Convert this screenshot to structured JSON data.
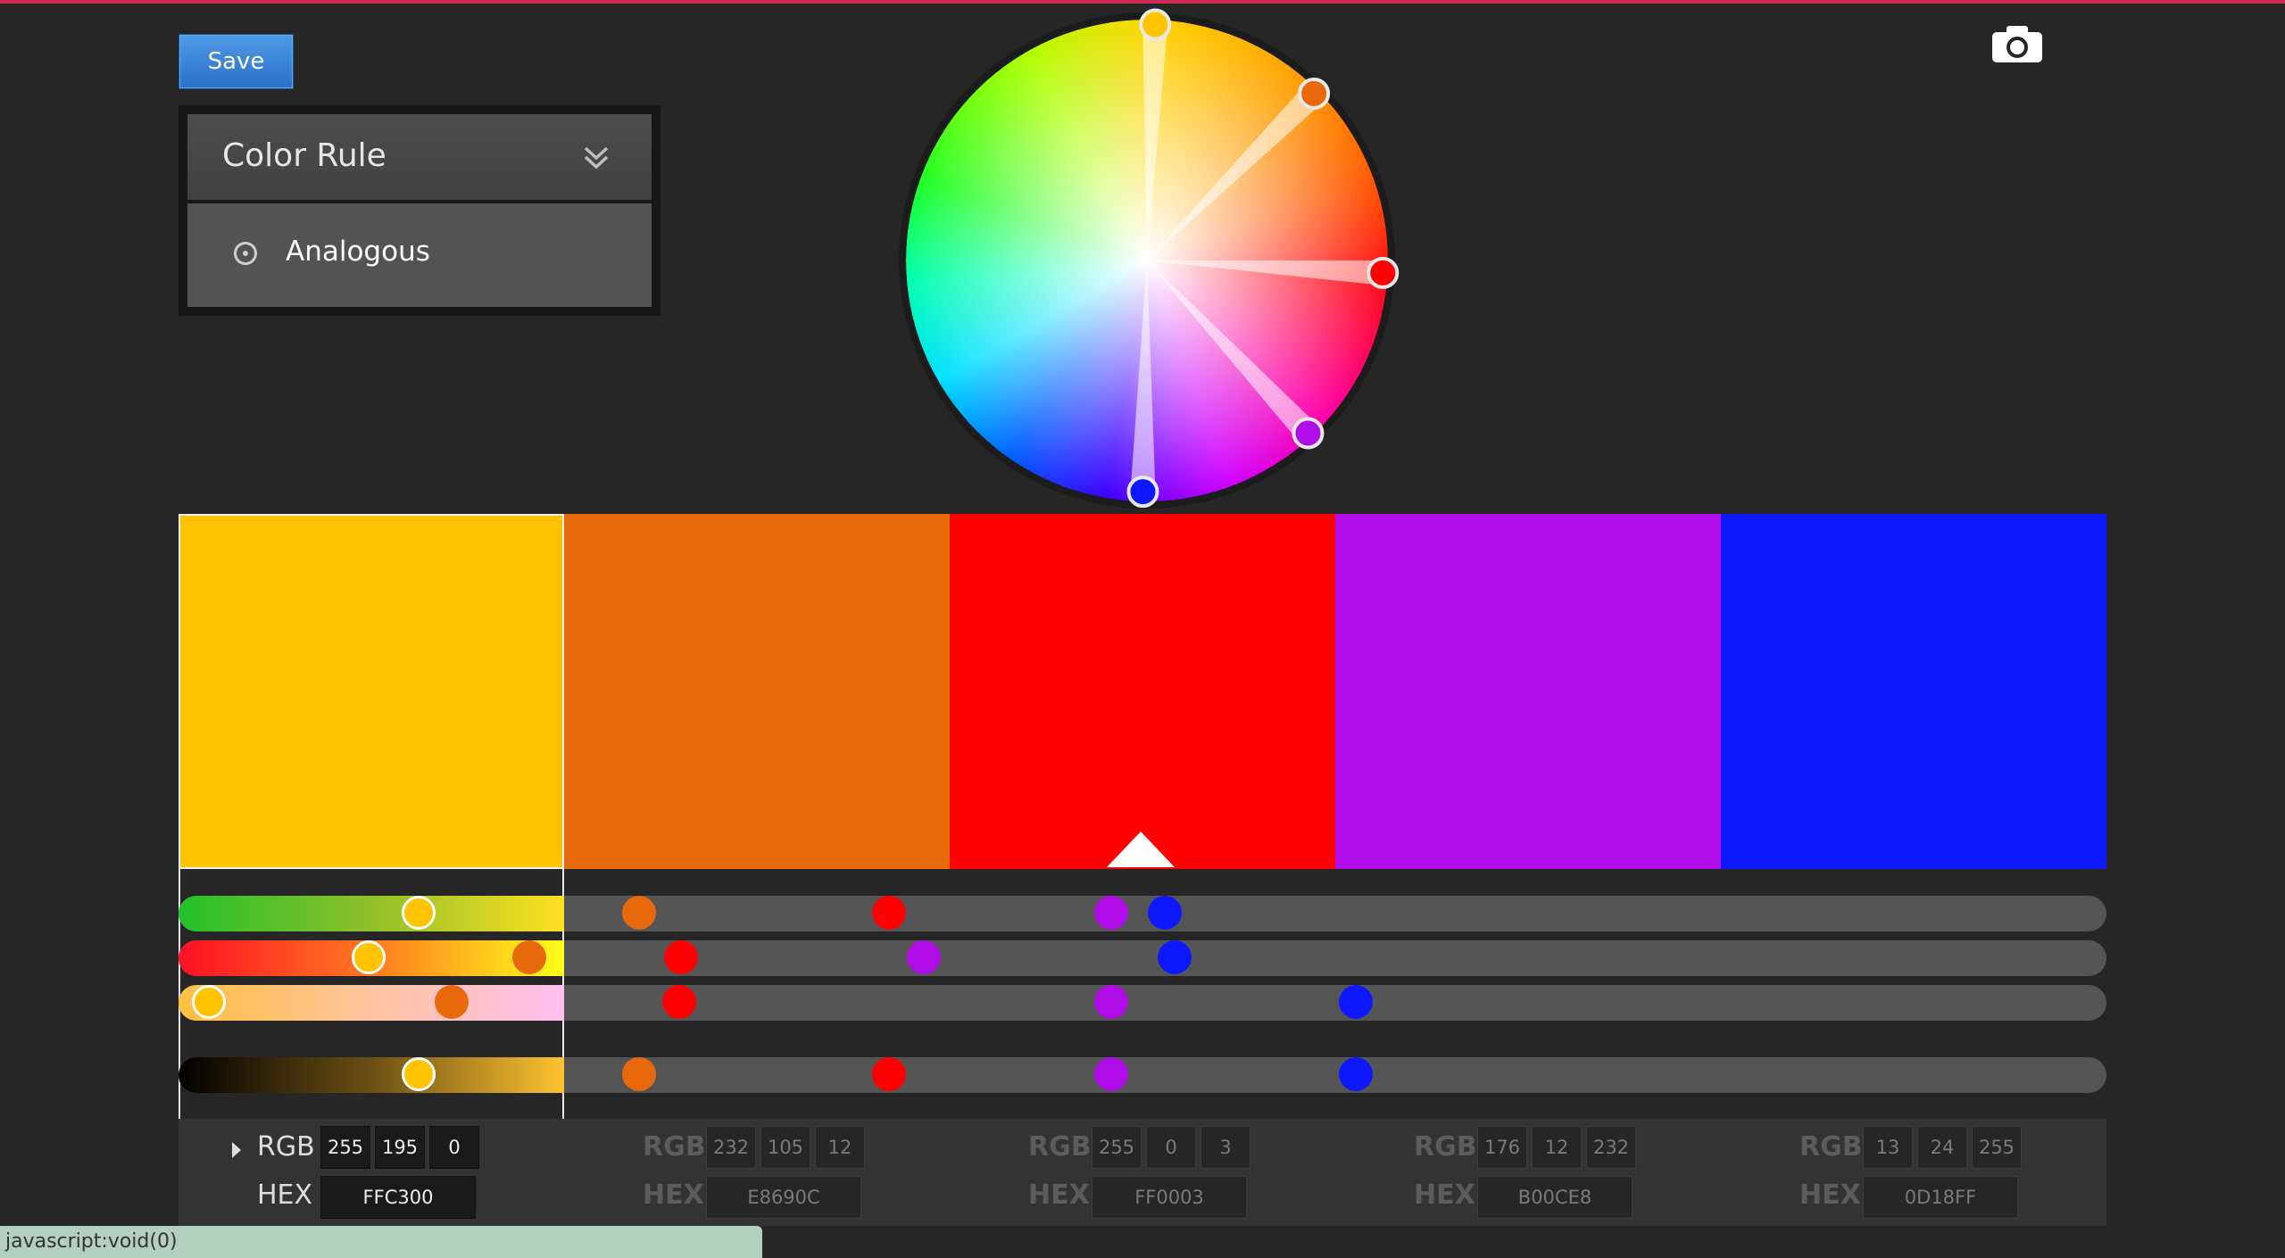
{
  "toolbar": {
    "save_label": "Save",
    "camera_icon": "camera-icon"
  },
  "color_rule": {
    "title": "Color Rule",
    "selected": "Analogous",
    "icons": {
      "expand": "double-chevron-down-icon",
      "radio": "radio-selected-icon"
    }
  },
  "swatches": [
    {
      "hex_color": "#FFC300",
      "rgb": [
        "255",
        "195",
        "0"
      ],
      "hex": "FFC300",
      "selected": true
    },
    {
      "hex_color": "#E8690C",
      "rgb": [
        "232",
        "105",
        "12"
      ],
      "hex": "E8690C",
      "selected": false
    },
    {
      "hex_color": "#FF0003",
      "rgb": [
        "255",
        "0",
        "3"
      ],
      "hex": "FF0003",
      "selected": false
    },
    {
      "hex_color": "#B00CE8",
      "rgb": [
        "176",
        "12",
        "232"
      ],
      "hex": "B00CE8",
      "selected": false
    },
    {
      "hex_color": "#0D18FF",
      "rgb": [
        "13",
        "24",
        "255"
      ],
      "hex": "0D18FF",
      "selected": false
    }
  ],
  "labels": {
    "rgb": "RGB",
    "hex": "HEX"
  },
  "wheel_handles": [
    {
      "name": "handle-yellow",
      "color": "#FFC300",
      "angle_deg": 2,
      "radius_frac": 0.98
    },
    {
      "name": "handle-orange",
      "color": "#E8690C",
      "angle_deg": 45,
      "radius_frac": 0.98
    },
    {
      "name": "handle-red",
      "color": "#FF0003",
      "angle_deg": 93,
      "radius_frac": 0.98
    },
    {
      "name": "handle-purple",
      "color": "#B00CE8",
      "angle_deg": 137,
      "radius_frac": 0.98
    },
    {
      "name": "handle-blue",
      "color": "#0D18FF",
      "angle_deg": 181,
      "radius_frac": 0.96
    }
  ],
  "sliders": [
    {
      "name": "hue-slider",
      "gradient": "linear-gradient(90deg,#22c02a,#8fc02a,#ffe020)",
      "knobs": [
        0.115,
        0.229,
        0.359,
        0.474,
        0.502
      ]
    },
    {
      "name": "saturation-slider",
      "gradient": "linear-gradient(90deg,#ff0f25,#ff7a20,#ffff1a)",
      "knobs": [
        0.089,
        0.172,
        0.251,
        0.377,
        0.507
      ]
    },
    {
      "name": "brightness-slider",
      "gradient": "linear-gradient(90deg,#ffc040,#ffc4a0,#ffc0f0)",
      "knobs": [
        0.006,
        0.132,
        0.25,
        0.474,
        0.601
      ]
    },
    {
      "name": "shade-slider",
      "gradient": "linear-gradient(90deg,#000,#6b4f14,#ffc330)",
      "knobs": [
        0.115,
        0.229,
        0.359,
        0.474,
        0.601
      ]
    }
  ],
  "status": {
    "text": "javascript:void(0)"
  }
}
